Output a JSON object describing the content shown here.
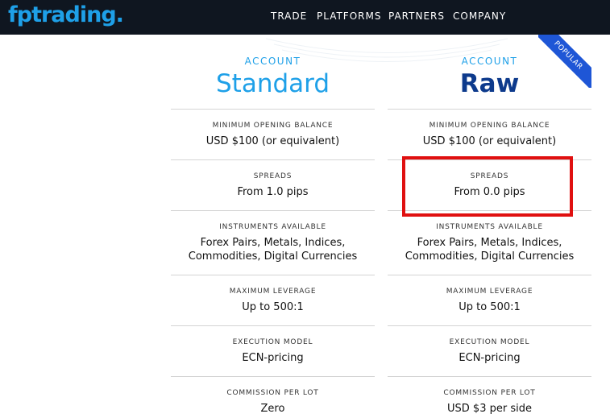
{
  "header": {
    "logo": "fptrading.",
    "nav": [
      "TRADE",
      "PLATFORMS",
      "PARTNERS",
      "COMPANY"
    ]
  },
  "accounts": [
    {
      "label": "ACCOUNT",
      "name": "Standard",
      "rows": [
        {
          "label": "MINIMUM OPENING BALANCE",
          "value": "USD $100 (or equivalent)"
        },
        {
          "label": "SPREADS",
          "value": "From 1.0 pips"
        },
        {
          "label": "INSTRUMENTS AVAILABLE",
          "value": "Forex Pairs, Metals, Indices,",
          "value2": "Commodities, Digital Currencies"
        },
        {
          "label": "MAXIMUM LEVERAGE",
          "value": "Up to 500:1"
        },
        {
          "label": "EXECUTION MODEL",
          "value": "ECN-pricing"
        },
        {
          "label": "COMMISSION PER LOT",
          "value": "Zero"
        }
      ]
    },
    {
      "label": "ACCOUNT",
      "name": "Raw",
      "badge": "POPULAR",
      "rows": [
        {
          "label": "MINIMUM OPENING BALANCE",
          "value": "USD $100 (or equivalent)"
        },
        {
          "label": "SPREADS",
          "value": "From 0.0 pips"
        },
        {
          "label": "INSTRUMENTS AVAILABLE",
          "value": "Forex Pairs, Metals, Indices,",
          "value2": "Commodities, Digital Currencies"
        },
        {
          "label": "MAXIMUM LEVERAGE",
          "value": "Up to 500:1"
        },
        {
          "label": "EXECUTION MODEL",
          "value": "ECN-pricing"
        },
        {
          "label": "COMMISSION PER LOT",
          "value": "USD $3 per side"
        }
      ]
    }
  ],
  "colors": {
    "nav_bg": "#0f1620",
    "brand_blue": "#1ea0e8",
    "raw_navy": "#0d3a8c",
    "ribbon": "#1e56d6",
    "highlight": "#e01010"
  }
}
